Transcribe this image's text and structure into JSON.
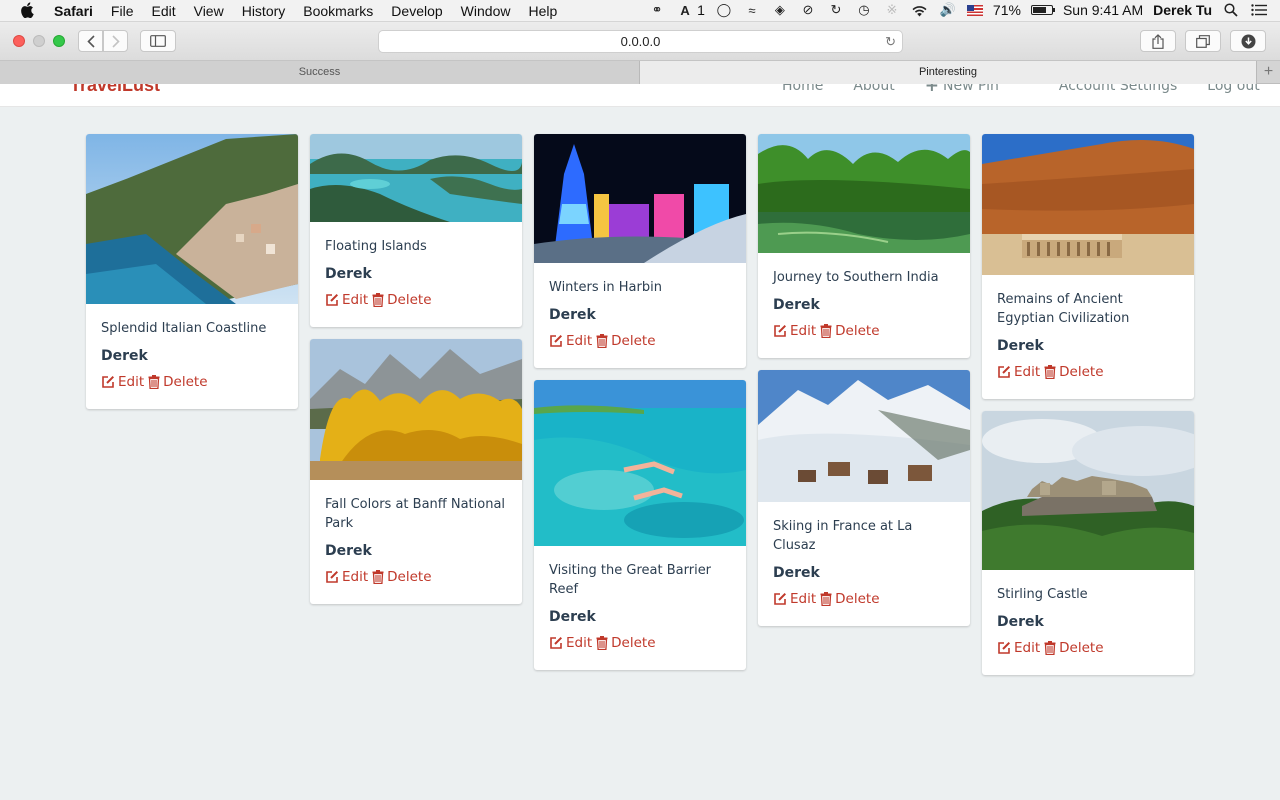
{
  "menubar": {
    "app": "Safari",
    "menus": [
      "File",
      "Edit",
      "View",
      "History",
      "Bookmarks",
      "Develop",
      "Window",
      "Help"
    ],
    "adobe_count": "1",
    "battery": "71%",
    "clock": "Sun 9:41 AM",
    "user": "Derek Tu"
  },
  "toolbar": {
    "url": "0.0.0.0"
  },
  "tabs": [
    {
      "label": "Success"
    },
    {
      "label": "Pinteresting"
    }
  ],
  "site": {
    "brand": "TravelLust",
    "nav": [
      "Home",
      "About",
      "New Pin",
      "Account Settings",
      "Log out"
    ]
  },
  "labels": {
    "edit": "Edit",
    "delete": "Delete"
  },
  "colors": {
    "accent": "#c0392b",
    "background": "#ecf0f1",
    "text": "#2c3e50"
  },
  "pins": [
    {
      "title": "Splendid Italian Coastline",
      "author": "Derek"
    },
    {
      "title": "Floating Islands",
      "author": "Derek"
    },
    {
      "title": "Fall Colors at Banff National Park",
      "author": "Derek"
    },
    {
      "title": "Winters in Harbin",
      "author": "Derek"
    },
    {
      "title": "Visiting the Great Barrier Reef",
      "author": "Derek"
    },
    {
      "title": "Journey to Southern India",
      "author": "Derek"
    },
    {
      "title": "Skiing in France at La Clusaz",
      "author": "Derek"
    },
    {
      "title": "Remains of Ancient Egyptian Civilization",
      "author": "Derek"
    },
    {
      "title": "Stirling Castle",
      "author": "Derek"
    }
  ]
}
